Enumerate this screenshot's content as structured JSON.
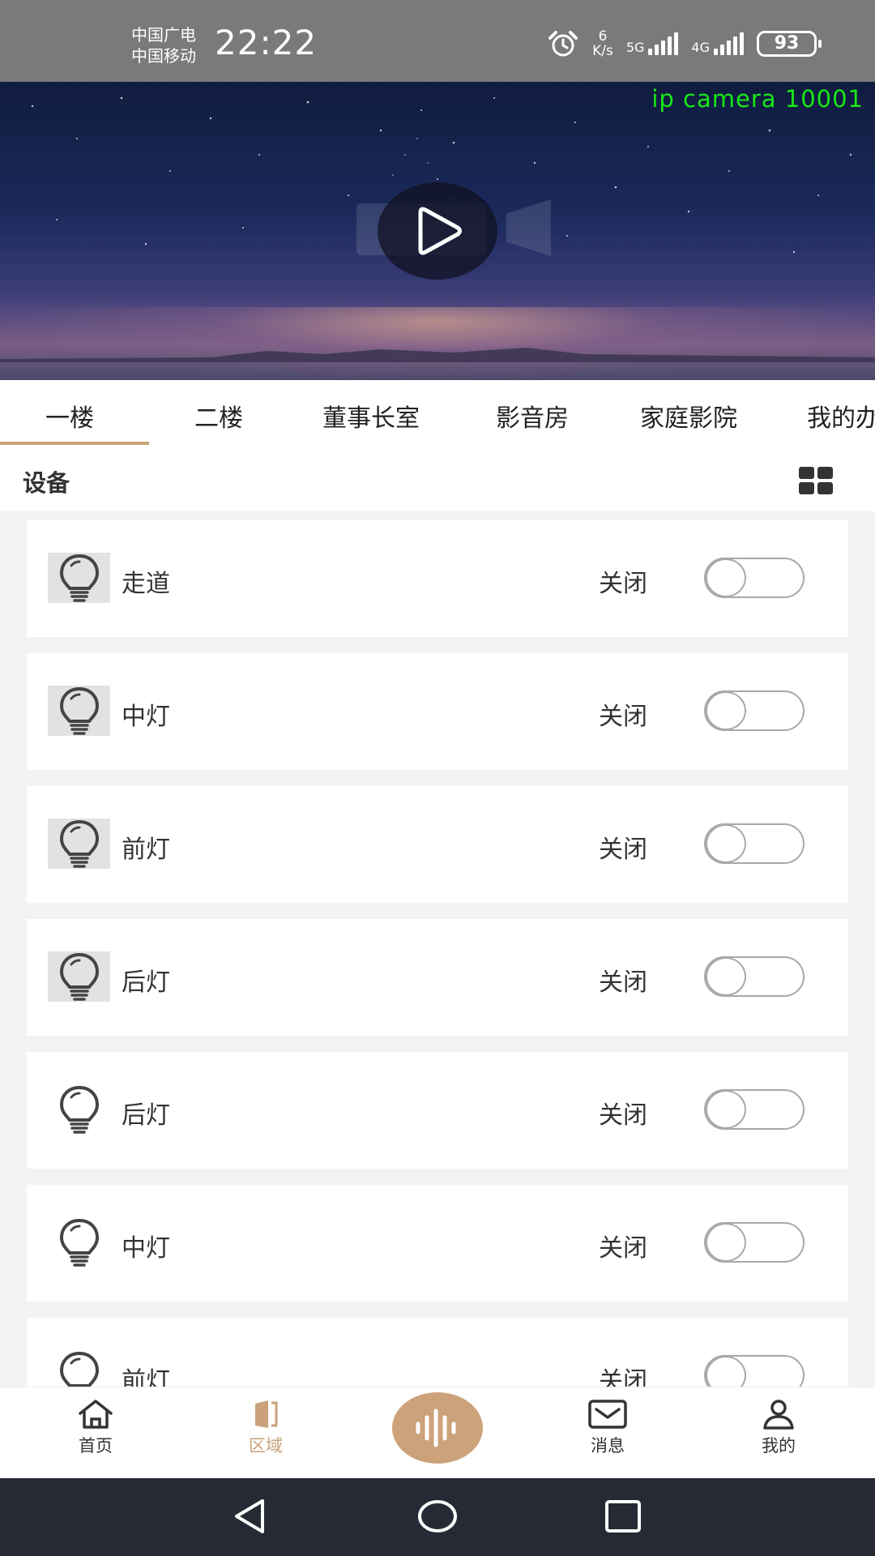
{
  "status_bar": {
    "carrier_1": "中国广电",
    "carrier_2": "中国移动",
    "time": "22:22",
    "speed_value": "6",
    "speed_unit": "K/s",
    "network_1": "5G",
    "network_2": "4G",
    "battery": "93"
  },
  "video": {
    "camera_title": "ip camera 10001"
  },
  "tabs": [
    {
      "label": "一楼",
      "active": true
    },
    {
      "label": "二楼",
      "active": false
    },
    {
      "label": "董事长室",
      "active": false
    },
    {
      "label": "影音房",
      "active": false
    },
    {
      "label": "家庭影院",
      "active": false
    },
    {
      "label": "我的办",
      "active": false
    }
  ],
  "section": {
    "title": "设备"
  },
  "devices": [
    {
      "name": "走道",
      "state": "关闭",
      "on": false
    },
    {
      "name": "中灯",
      "state": "关闭",
      "on": false
    },
    {
      "name": "前灯",
      "state": "关闭",
      "on": false
    },
    {
      "name": "后灯",
      "state": "关闭",
      "on": false
    },
    {
      "name": "后灯",
      "state": "关闭",
      "on": false
    },
    {
      "name": "中灯",
      "state": "关闭",
      "on": false
    },
    {
      "name": "前灯",
      "state": "关闭",
      "on": false
    }
  ],
  "bottom_nav": {
    "home": "首页",
    "area": "区域",
    "messages": "消息",
    "mine": "我的"
  },
  "colors": {
    "accent": "#c9a27a",
    "status_bar": "#7a7a7a",
    "camera_text": "#18e818",
    "system_nav": "#252a35"
  }
}
